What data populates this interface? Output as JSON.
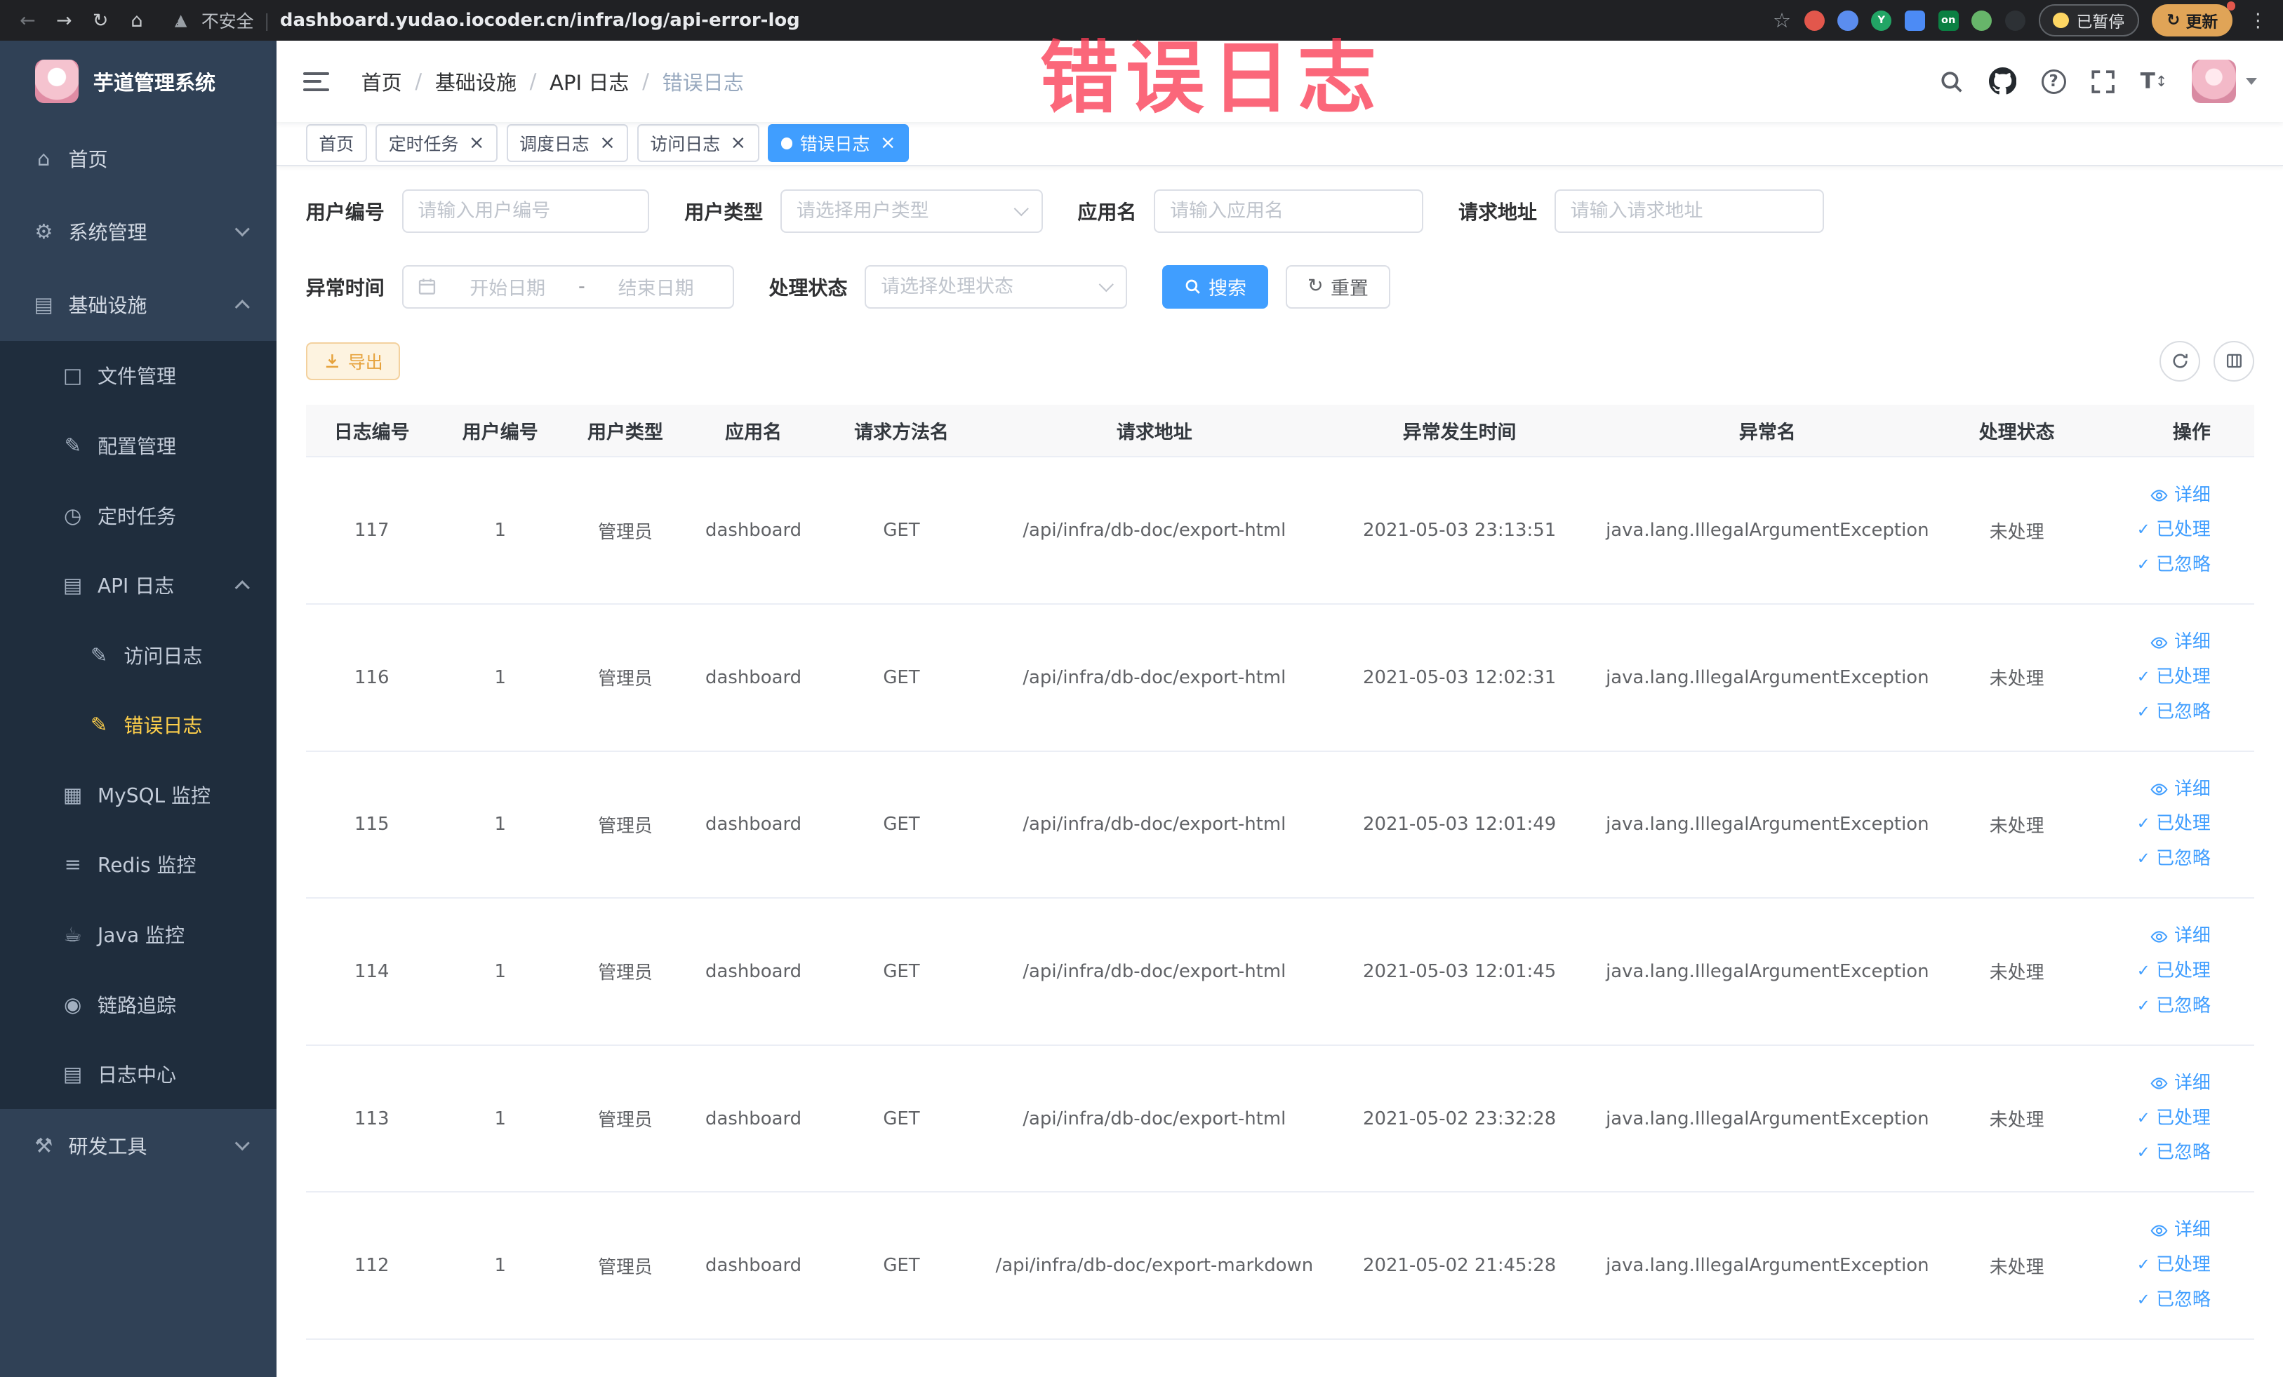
{
  "browser": {
    "security_label": "不安全",
    "url": "dashboard.yudao.iocoder.cn/infra/log/api-error-log",
    "paused_label": "已暂停",
    "update_label": "更新"
  },
  "sidebar": {
    "logo_title": "芋道管理系统",
    "items": [
      {
        "key": "home",
        "label": "首页",
        "icon": "home-icon",
        "level": 1
      },
      {
        "key": "system",
        "label": "系统管理",
        "icon": "gear-icon",
        "level": 1,
        "arrow": "down"
      },
      {
        "key": "infrastructure",
        "label": "基础设施",
        "icon": "infrastructure-icon",
        "level": 1,
        "arrow": "up"
      },
      {
        "key": "file",
        "label": "文件管理",
        "icon": "file-icon",
        "level": 2
      },
      {
        "key": "config",
        "label": "配置管理",
        "icon": "config-icon",
        "level": 2
      },
      {
        "key": "job",
        "label": "定时任务",
        "icon": "timer-icon",
        "level": 2
      },
      {
        "key": "api-log",
        "label": "API 日志",
        "icon": "api-log-icon",
        "level": 2,
        "arrow": "up"
      },
      {
        "key": "access-log",
        "label": "访问日志",
        "icon": "access-log-icon",
        "level": 3
      },
      {
        "key": "error-log",
        "label": "错误日志",
        "icon": "error-log-icon",
        "level": 3,
        "active": true
      },
      {
        "key": "mysql",
        "label": "MySQL 监控",
        "icon": "mysql-icon",
        "level": 2
      },
      {
        "key": "redis",
        "label": "Redis 监控",
        "icon": "redis-icon",
        "level": 2
      },
      {
        "key": "java",
        "label": "Java 监控",
        "icon": "java-icon",
        "level": 2
      },
      {
        "key": "trace",
        "label": "链路追踪",
        "icon": "trace-icon",
        "level": 2
      },
      {
        "key": "log-center",
        "label": "日志中心",
        "icon": "log-center-icon",
        "level": 2
      },
      {
        "key": "dev-tools",
        "label": "研发工具",
        "icon": "tools-icon",
        "level": 1,
        "arrow": "down"
      }
    ]
  },
  "navbar": {
    "breadcrumb": [
      "首页",
      "基础设施",
      "API 日志",
      "错误日志"
    ]
  },
  "watermark": "错误日志",
  "tags_view": [
    {
      "key": "home",
      "label": "首页",
      "closable": false,
      "active": false
    },
    {
      "key": "job",
      "label": "定时任务",
      "closable": true,
      "active": false
    },
    {
      "key": "job-log",
      "label": "调度日志",
      "closable": true,
      "active": false
    },
    {
      "key": "access-log",
      "label": "访问日志",
      "closable": true,
      "active": false
    },
    {
      "key": "error-log",
      "label": "错误日志",
      "closable": true,
      "active": true
    }
  ],
  "filters": {
    "user_id": {
      "label": "用户编号",
      "placeholder": "请输入用户编号",
      "value": ""
    },
    "user_type": {
      "label": "用户类型",
      "placeholder": "请选择用户类型",
      "value": ""
    },
    "app_name": {
      "label": "应用名",
      "placeholder": "请输入应用名",
      "value": ""
    },
    "request_url": {
      "label": "请求地址",
      "placeholder": "请输入请求地址",
      "value": ""
    },
    "exception_time": {
      "label": "异常时间",
      "start_placeholder": "开始日期",
      "separator": "-",
      "end_placeholder": "结束日期"
    },
    "process_status": {
      "label": "处理状态",
      "placeholder": "请选择处理状态",
      "value": ""
    },
    "search_label": "搜索",
    "reset_label": "重置"
  },
  "toolbar": {
    "export_label": "导出"
  },
  "table": {
    "columns": [
      "日志编号",
      "用户编号",
      "用户类型",
      "应用名",
      "请求方法名",
      "请求地址",
      "异常发生时间",
      "异常名",
      "处理状态",
      "操作"
    ],
    "rows": [
      {
        "log_id": 117,
        "user_id": 1,
        "user_type": "管理员",
        "app_name": "dashboard",
        "method": "GET",
        "url": "/api/infra/db-doc/export-html",
        "time": "2021-05-03 23:13:51",
        "exception": "java.lang.IllegalArgumentException",
        "status": "未处理"
      },
      {
        "log_id": 116,
        "user_id": 1,
        "user_type": "管理员",
        "app_name": "dashboard",
        "method": "GET",
        "url": "/api/infra/db-doc/export-html",
        "time": "2021-05-03 12:02:31",
        "exception": "java.lang.IllegalArgumentException",
        "status": "未处理"
      },
      {
        "log_id": 115,
        "user_id": 1,
        "user_type": "管理员",
        "app_name": "dashboard",
        "method": "GET",
        "url": "/api/infra/db-doc/export-html",
        "time": "2021-05-03 12:01:49",
        "exception": "java.lang.IllegalArgumentException",
        "status": "未处理"
      },
      {
        "log_id": 114,
        "user_id": 1,
        "user_type": "管理员",
        "app_name": "dashboard",
        "method": "GET",
        "url": "/api/infra/db-doc/export-html",
        "time": "2021-05-03 12:01:45",
        "exception": "java.lang.IllegalArgumentException",
        "status": "未处理"
      },
      {
        "log_id": 113,
        "user_id": 1,
        "user_type": "管理员",
        "app_name": "dashboard",
        "method": "GET",
        "url": "/api/infra/db-doc/export-html",
        "time": "2021-05-02 23:32:28",
        "exception": "java.lang.IllegalArgumentException",
        "status": "未处理"
      },
      {
        "log_id": 112,
        "user_id": 1,
        "user_type": "管理员",
        "app_name": "dashboard",
        "method": "GET",
        "url": "/api/infra/db-doc/export-markdown",
        "time": "2021-05-02 21:45:28",
        "exception": "java.lang.IllegalArgumentException",
        "status": "未处理"
      }
    ],
    "row_actions": [
      {
        "key": "detail",
        "label": "详细",
        "icon": "view-icon"
      },
      {
        "key": "processed",
        "label": "已处理",
        "icon": "check-icon"
      },
      {
        "key": "ignored",
        "label": "已忽略",
        "icon": "check-icon"
      }
    ]
  },
  "colors": {
    "primary": "#409eff",
    "sidebar_bg": "#304156",
    "submenu_bg": "#1f2d3d",
    "active_menu_text": "#ffd04b",
    "warning_accent": "#e6a23c",
    "watermark_red": "#fa3c54"
  }
}
